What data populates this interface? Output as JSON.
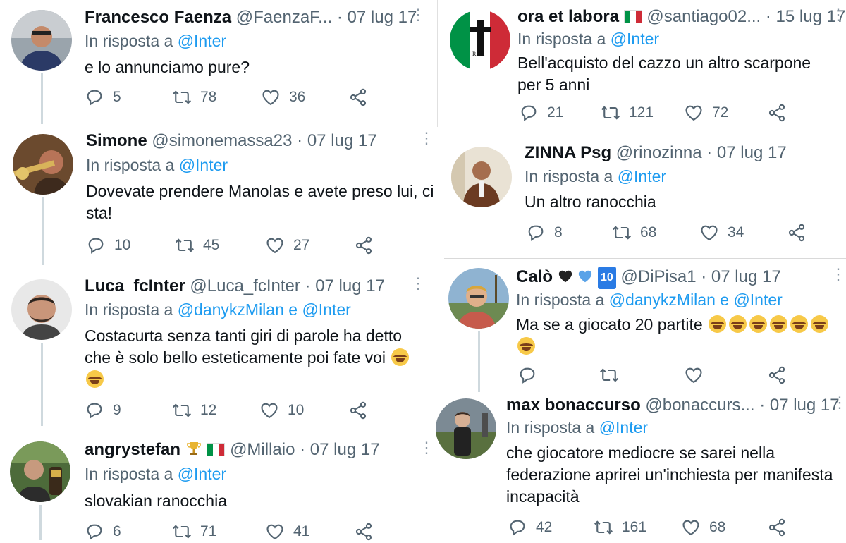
{
  "left": [
    {
      "name": "Francesco Faenza",
      "handle": "@FaenzaF...",
      "sep": "·",
      "date": "07 lug 17",
      "reply_prefix": "In risposta a",
      "reply_to": "@Inter",
      "text": "e lo annunciamo pure?",
      "replies": "5",
      "retweets": "78",
      "likes": "36"
    },
    {
      "name": "Simone",
      "handle": "@simonemassa23",
      "sep": "·",
      "date": "07 lug 17",
      "reply_prefix": "In risposta a",
      "reply_to": "@Inter",
      "text": "Dovevate prendere Manolas e avete preso lui, ci sta!",
      "replies": "10",
      "retweets": "45",
      "likes": "27"
    },
    {
      "name": "Luca_fcInter",
      "handle": "@Luca_fcInter",
      "sep": "·",
      "date": "07 lug 17",
      "reply_prefix": "In risposta a",
      "reply_to": "@danykzMilan e @Inter",
      "text": "Costacurta senza tanti giri di parole ha detto che è solo bello esteticamente poi fate voi",
      "replies": "9",
      "retweets": "12",
      "likes": "10"
    },
    {
      "name": "angrystefan",
      "handle": "@Millaio",
      "sep": "·",
      "date": "07 lug 17",
      "reply_prefix": "In risposta a",
      "reply_to": "@Inter",
      "text": "slovakian ranocchia",
      "replies": "6",
      "retweets": "71",
      "likes": "41"
    }
  ],
  "right": [
    {
      "name": "ora et labora",
      "handle": "@santiago02...",
      "sep": "·",
      "date": "15 lug 17",
      "reply_prefix": "In risposta a",
      "reply_to": "@Inter",
      "text": "Bell'acquisto del cazzo un altro scarpone per 5 anni",
      "replies": "21",
      "retweets": "121",
      "likes": "72",
      "avatar_caption": "R.I.P."
    },
    {
      "name": "ZINNA Psg",
      "handle": "@rinozinna",
      "sep": "·",
      "date": "07 lug 17",
      "reply_prefix": "In risposta a",
      "reply_to": "@Inter",
      "text": "Un altro ranocchia",
      "replies": "8",
      "retweets": "68",
      "likes": "34"
    },
    {
      "name": "Calò",
      "badge": "10",
      "handle": "@DiPisa1",
      "sep": "·",
      "date": "07 lug 17",
      "reply_prefix": "In risposta a",
      "reply_to": "@danykzMilan e @Inter",
      "text": "Ma se a giocato 20 partite",
      "replies": "",
      "retweets": "",
      "likes": ""
    },
    {
      "name": "max bonaccurso",
      "handle": "@bonaccurs...",
      "sep": "·",
      "date": "07 lug 17",
      "reply_prefix": "In risposta a",
      "reply_to": "@Inter",
      "text": "che giocatore mediocre se sarei nella federazione aprirei un'inchiesta per manifesta incapacità",
      "replies": "42",
      "retweets": "161",
      "likes": "68"
    }
  ],
  "more_glyph": "⋮",
  "colors": {
    "accent": "#1d9bf0",
    "muted": "#536471",
    "text": "#0f1419",
    "divider": "#d9d9d9"
  }
}
